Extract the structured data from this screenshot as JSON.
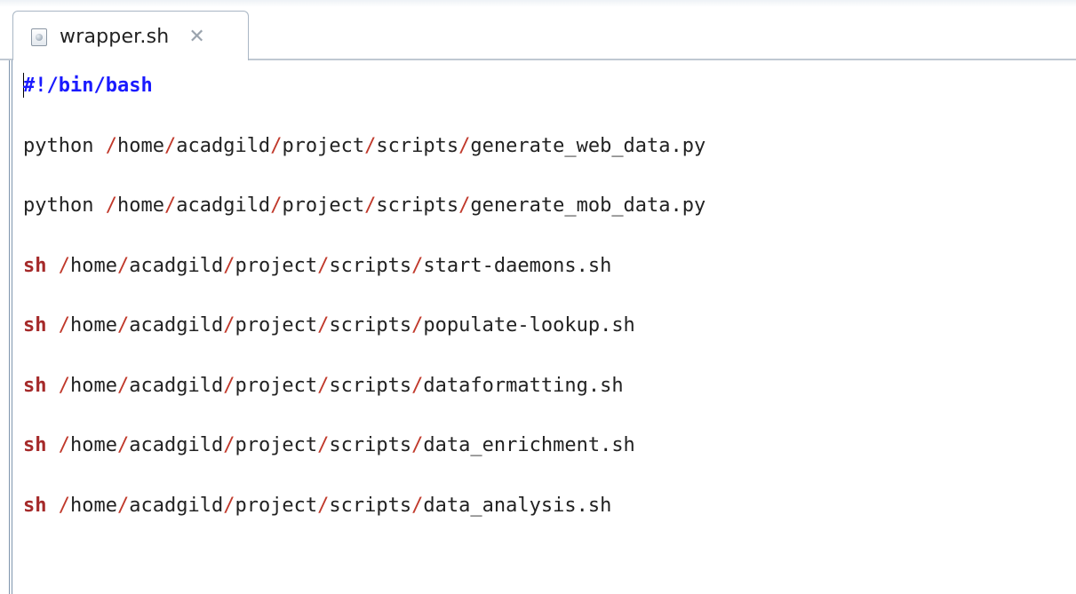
{
  "tab": {
    "label": "wrapper.sh",
    "close_glyph": "✕",
    "icon": "shell-file-icon"
  },
  "code": {
    "lines": [
      {
        "prefix": "",
        "shebang": "#!/bin/bash",
        "path": []
      },
      {
        "prefix": "python",
        "shebang": "",
        "path": [
          "home",
          "acadgild",
          "project",
          "scripts",
          "generate_web_data.py"
        ]
      },
      {
        "prefix": "python",
        "shebang": "",
        "path": [
          "home",
          "acadgild",
          "project",
          "scripts",
          "generate_mob_data.py"
        ]
      },
      {
        "prefix": "sh",
        "shebang": "",
        "path": [
          "home",
          "acadgild",
          "project",
          "scripts",
          "start-daemons.sh"
        ]
      },
      {
        "prefix": "sh",
        "shebang": "",
        "path": [
          "home",
          "acadgild",
          "project",
          "scripts",
          "populate-lookup.sh"
        ]
      },
      {
        "prefix": "sh",
        "shebang": "",
        "path": [
          "home",
          "acadgild",
          "project",
          "scripts",
          "dataformatting.sh"
        ]
      },
      {
        "prefix": "sh",
        "shebang": "",
        "path": [
          "home",
          "acadgild",
          "project",
          "scripts",
          "data_enrichment.sh"
        ]
      },
      {
        "prefix": "sh",
        "shebang": "",
        "path": [
          "home",
          "acadgild",
          "project",
          "scripts",
          "data_analysis.sh"
        ]
      }
    ]
  },
  "colors": {
    "shebang": "#1a1aff",
    "keyword_sh": "#a52a2a",
    "path_slash": "#c0392b",
    "text": "#222222"
  }
}
